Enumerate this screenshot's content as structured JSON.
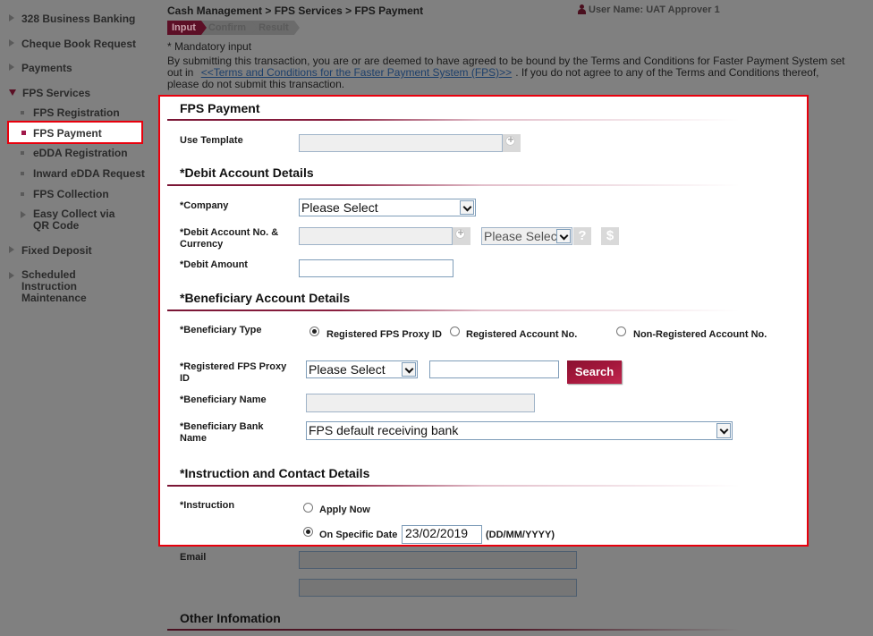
{
  "sidebar": {
    "items": [
      {
        "label": "328 Business Banking",
        "icon": "chevron-right-icon"
      },
      {
        "label": "Cheque Book Request",
        "icon": "chevron-right-icon"
      },
      {
        "label": "Payments",
        "icon": "chevron-right-icon"
      },
      {
        "label": "FPS Services",
        "icon": "chevron-down-icon",
        "expanded": true,
        "children": [
          {
            "label": "FPS Registration"
          },
          {
            "label": "FPS Payment",
            "active": true
          },
          {
            "label": "eDDA Registration"
          },
          {
            "label": "Inward eDDA Request"
          },
          {
            "label": "FPS Collection"
          },
          {
            "label": "Easy Collect via QR Code",
            "expandable": true
          }
        ]
      },
      {
        "label": "Fixed Deposit",
        "icon": "chevron-right-icon"
      },
      {
        "label": "Scheduled Instruction Maintenance",
        "icon": "chevron-right-icon"
      }
    ]
  },
  "header": {
    "breadcrumb": "Cash Management > FPS Services > FPS Payment",
    "user_label": "User Name: UAT Approver 1",
    "steps": [
      "Input",
      "Confirm",
      "Result"
    ],
    "active_step": "Input",
    "mandatory_note": "* Mandatory input",
    "disclaimer_pre": "By submitting this transaction, you are or are deemed to have agreed to be bound by the Terms and Conditions for Faster Payment System set out in",
    "disclaimer_link": "<<Terms and Conditions for the Faster Payment System (FPS)>>",
    "disclaimer_post": ". If you do not agree to any of the Terms and Conditions thereof, please do not submit this transaction."
  },
  "form": {
    "title": "FPS Payment",
    "use_template": {
      "label": "Use Template",
      "value": ""
    },
    "debit_section": {
      "title": "*Debit Account Details",
      "company": {
        "label": "*Company",
        "selected": "Please Select"
      },
      "debit_account": {
        "label": "*Debit Account No. & Currency",
        "value": "",
        "currency_selected": "Please Select"
      },
      "debit_amount": {
        "label": "*Debit Amount",
        "value": ""
      }
    },
    "beneficiary_section": {
      "title": "*Beneficiary Account Details",
      "type": {
        "label": "*Beneficiary Type",
        "options": [
          "Registered FPS Proxy ID",
          "Registered Account No.",
          "Non-Registered Account No."
        ],
        "selected": "Registered FPS Proxy ID"
      },
      "proxy_id": {
        "label": "*Registered FPS Proxy ID",
        "selected": "Please Select",
        "value": "",
        "search_label": "Search"
      },
      "name": {
        "label": "*Beneficiary Name",
        "value": ""
      },
      "bank": {
        "label": "*Beneficiary Bank Name",
        "selected": "FPS default receiving bank"
      }
    },
    "instruction_section": {
      "title": "*Instruction and Contact Details",
      "instruction": {
        "label": "*Instruction",
        "options": [
          "Apply Now",
          "On Specific Date"
        ],
        "selected": "On Specific Date",
        "date_value": "23/02/2019",
        "date_format": "(DD/MM/YYYY)"
      },
      "email": {
        "label": "Email",
        "value1": "",
        "value2": ""
      }
    },
    "other_section": {
      "title": "Other Infomation"
    }
  },
  "colors": {
    "accent": "#8a1130",
    "highlight_border": "#e8000d",
    "overlay": "#808080"
  }
}
